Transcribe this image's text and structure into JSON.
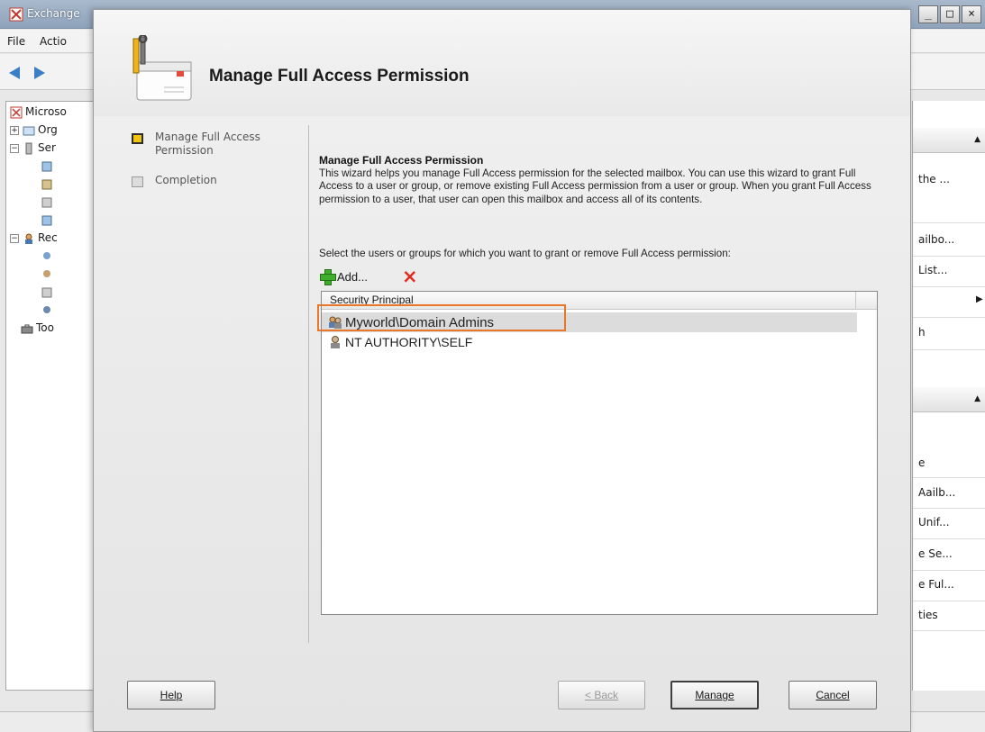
{
  "mmc": {
    "title": "Exchange",
    "window_controls": [
      "_",
      "□",
      "×"
    ],
    "menu": [
      "File",
      "Actio"
    ],
    "tree": [
      "Microso",
      "Org",
      "Ser",
      "Rec",
      "Too"
    ],
    "actions": [
      "the ...",
      "ailbo...",
      "List...",
      "h",
      "e",
      "Aailb...",
      "Unif...",
      "e Se...",
      "e Ful...",
      "ties"
    ]
  },
  "dialog": {
    "title": "Manage Full Access Permission",
    "nav": [
      {
        "label": "Manage Full Access Permission",
        "active": true
      },
      {
        "label": "Completion",
        "active": false
      }
    ],
    "content_title": "Manage Full Access Permission",
    "description": "This wizard helps you manage Full Access permission for the selected mailbox. You can use this wizard to grant Full Access to a user or group, or remove existing Full Access permission from a user or group. When you grant Full Access permission to a user, that user can open this mailbox and access all of its contents.",
    "select_label": "Select the users or groups for which you want to grant or remove Full Access permission:",
    "toolbar": {
      "add_label": "Add...",
      "remove_icon": "×"
    },
    "list": {
      "column_header": "Security Principal",
      "rows": [
        {
          "name": "Myworld\\Domain Admins",
          "icon": "group-icon",
          "selected": true
        },
        {
          "name": "NT AUTHORITY\\SELF",
          "icon": "user-icon",
          "selected": false
        }
      ]
    },
    "buttons": {
      "help": "Help",
      "back": "< Back",
      "manage": "Manage",
      "cancel": "Cancel"
    }
  },
  "colors": {
    "highlight": "#e8772b",
    "active_step": "#f1c40f",
    "add_icon": "#3fae2a",
    "remove_icon": "#e02a1c"
  }
}
